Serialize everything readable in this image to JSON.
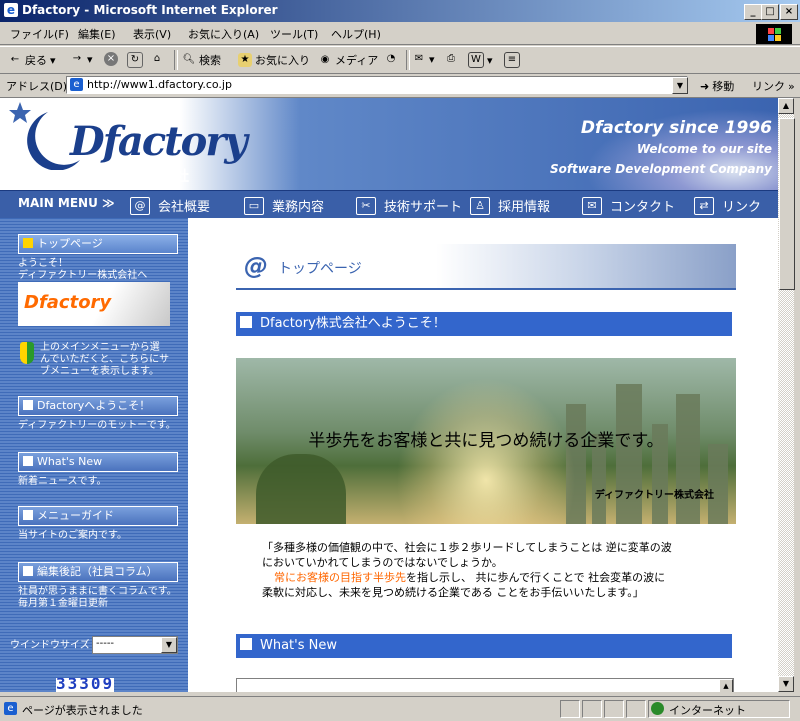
{
  "window": {
    "title": "Dfactory - Microsoft Internet Explorer"
  },
  "menu": [
    "ファイル(F)",
    "編集(E)",
    "表示(V)",
    "お気に入り(A)",
    "ツール(T)",
    "ヘルプ(H)"
  ],
  "toolbar": {
    "back": "戻る",
    "search": "検索",
    "favorites": "お気に入り",
    "media": "メディア"
  },
  "address": {
    "label": "アドレス(D)",
    "url": "http://www1.dfactory.co.jp",
    "go": "移動",
    "links": "リンク"
  },
  "header": {
    "logo": "Dfactory",
    "subtitle": "ディファクトリー株式会社",
    "since": "Dfactory since 1996",
    "welcome": "Welcome to our site",
    "tagline": "Software Development Company"
  },
  "nav": {
    "mainmenu": "MAIN MENU ≫",
    "items": [
      "会社概要",
      "業務内容",
      "技術サポート",
      "採用情報",
      "コンタクト",
      "リンク"
    ]
  },
  "sidebar": {
    "top": {
      "label": "トップページ",
      "text1": "ようこそ！",
      "text2": "ディファクトリー株式会社へ"
    },
    "thumb": "Dfactory",
    "help": [
      "上のメインメニューから選",
      "んでいただくと、こちらにサ",
      "ブメニューを表示します。"
    ],
    "welcome": {
      "label": "Dfactoryへようこそ！",
      "text": "ディファクトリーのモットーです。"
    },
    "whatsnew": {
      "label": "What's New",
      "text": "新着ニュースです。"
    },
    "guide": {
      "label": "メニューガイド",
      "text": "当サイトのご案内です。"
    },
    "column": {
      "label": "編集後記（社員コラム）",
      "text1": "社員が思うままに書くコラムです。",
      "text2": "毎月第１金曜日更新"
    },
    "winsize": {
      "label": "ウインドウサイズ",
      "value": "-----"
    },
    "counter": "33309"
  },
  "main": {
    "page_title": "トップページ",
    "welcome_bar": "Dfactory株式会社へようこそ！",
    "hero_message": "半歩先をお客様と共に見つめ続ける企業です。",
    "hero_company": "ディファクトリー株式会社",
    "intro_line1": "「多種多様の価値観の中で、社会に１歩２歩リードしてしまうことは 逆に変革の波",
    "intro_line2": "においていかれてしまうのではないでしょうか。",
    "intro_highlight": "常にお客様の目指す半歩先",
    "intro_line3_rest": "を指し示し、 共に歩んで行くことで 社会変革の波に",
    "intro_line4": "柔軟に対応し、未来を見つめ続ける企業である ことをお手伝いいたします。」",
    "whatsnew_bar": "What's New"
  },
  "status": {
    "text": "ページが表示されました",
    "zone": "インターネット"
  }
}
